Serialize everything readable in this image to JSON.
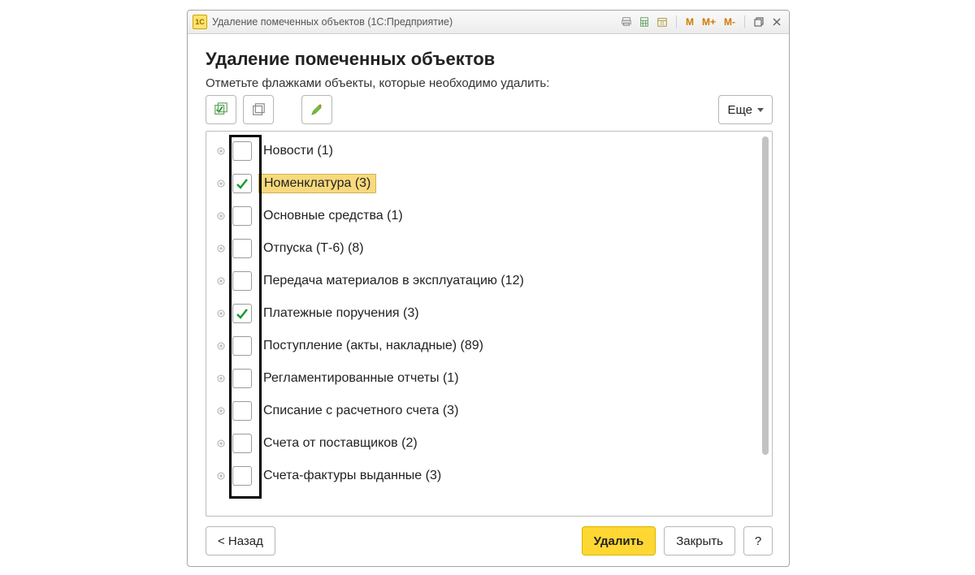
{
  "window": {
    "app_logo_text": "1C",
    "title": "Удаление помеченных объектов  (1С:Предприятие)",
    "mem_buttons": [
      "M",
      "M+",
      "M-"
    ]
  },
  "dialog": {
    "title": "Удаление помеченных объектов",
    "hint": "Отметьте флажками объекты, которые необходимо удалить:",
    "more_label": "Еще"
  },
  "items": [
    {
      "label": "Новости (1)",
      "checked": false,
      "selected": false
    },
    {
      "label": "Номенклатура (3)",
      "checked": true,
      "selected": true
    },
    {
      "label": "Основные средства (1)",
      "checked": false,
      "selected": false
    },
    {
      "label": "Отпуска (Т-6) (8)",
      "checked": false,
      "selected": false
    },
    {
      "label": "Передача материалов в эксплуатацию (12)",
      "checked": false,
      "selected": false
    },
    {
      "label": "Платежные поручения (3)",
      "checked": true,
      "selected": false
    },
    {
      "label": "Поступление (акты, накладные) (89)",
      "checked": false,
      "selected": false
    },
    {
      "label": "Регламентированные отчеты (1)",
      "checked": false,
      "selected": false
    },
    {
      "label": "Списание с расчетного счета (3)",
      "checked": false,
      "selected": false
    },
    {
      "label": "Счета от поставщиков (2)",
      "checked": false,
      "selected": false
    },
    {
      "label": "Счета-фактуры выданные (3)",
      "checked": false,
      "selected": false
    }
  ],
  "footer": {
    "back": "< Назад",
    "delete": "Удалить",
    "close": "Закрыть",
    "help": "?"
  },
  "colors": {
    "accent_check": "#1d9b2a",
    "selection_bg": "#f8da7d",
    "primary_btn": "#ffd733"
  }
}
